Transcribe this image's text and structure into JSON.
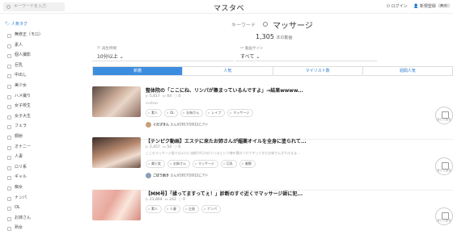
{
  "header": {
    "search_placeholder": "キーワードを入力",
    "logo": "マスタベ",
    "login": "ログイン",
    "signup": "新規登録（無料）"
  },
  "sidebar": {
    "title": "人気タグ",
    "items": [
      "無修正（モロ）",
      "素人",
      "個人撮影",
      "巨乳",
      "中出し",
      "美少女",
      "ハメ撮り",
      "女子校生",
      "女子大生",
      "フェラ",
      "顔射",
      "オナニー",
      "人妻",
      "ロリ系",
      "ギャル",
      "痴女",
      "ナンパ",
      "OL",
      "お姉さん",
      "熟女"
    ]
  },
  "main": {
    "keyword_label": "キーワード",
    "keyword_value": "マッサージ",
    "count_num": "1,305",
    "count_unit": "本の動画",
    "filter1_label": "再生時間",
    "filter1_value": "10分以上",
    "filter2_label": "動画サイト",
    "filter2_value": "すべて",
    "tabs": [
      "新着",
      "人気",
      "マイリスト数",
      "週間人気"
    ],
    "watch_label": "あとで見る"
  },
  "videos": [
    {
      "title": "整体院の「ここにね、リンパが集まっているんですよ」→結果wwww...",
      "views": "5,617",
      "mylist": "64",
      "comments": "0",
      "source": "xvideos",
      "tags": [
        "素人",
        "OL",
        "お姉さん",
        "レイプ",
        "マッサージ"
      ],
      "user": "ぐだざきん",
      "user_note": "さんが2017/10/12にアド"
    },
    {
      "title": "【テンピク動画】エステに来たお姉さんが媚薬オイルを全身に塗られて...",
      "views": "2,457",
      "mylist": "54",
      "comments": "0",
      "desc": "ここのマッサージ屋ではエロい施術が行われているという噂を聞きつけてやってきたお姉さんがそのまま...",
      "tags": [
        "美少女",
        "お姉さん",
        "マッサージ",
        "巨乳",
        "美脚"
      ],
      "user": "ごぼう助き",
      "user_note": "さんが2017/10/12にアド"
    },
    {
      "title": "【MM号】「揉ってますってぇ！」診断のすぐ近くでマッサージ師に犯...",
      "views": "23,664",
      "mylist": "242",
      "comments": "0",
      "tags": [
        "素人",
        "人妻",
        "企画",
        "ナンパ"
      ],
      "user": "",
      "user_note": ""
    }
  ],
  "colors": {
    "accent": "#3c8de0"
  }
}
